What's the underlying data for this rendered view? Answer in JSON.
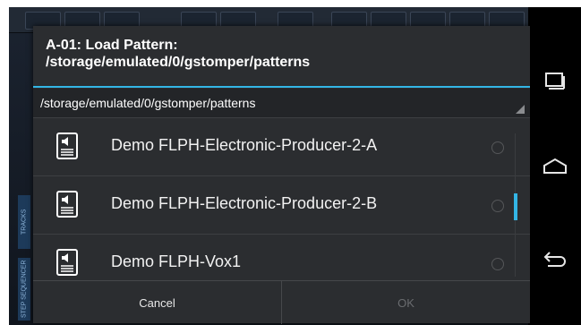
{
  "dialog": {
    "title_line1": "A-01: Load Pattern:",
    "title_line2": "/storage/emulated/0/gstomper/patterns",
    "path": "/storage/emulated/0/gstomper/patterns",
    "items": [
      {
        "label": "Demo FLPH-Electronic-Producer-2-A",
        "icon": "audio-file-icon"
      },
      {
        "label": "Demo FLPH-Electronic-Producer-2-B",
        "icon": "audio-file-icon"
      },
      {
        "label": "Demo FLPH-Vox1",
        "icon": "audio-file-icon"
      }
    ],
    "cancel_label": "Cancel",
    "ok_label": "OK"
  },
  "background": {
    "tab_tracks": "TRACKS",
    "tab_step_sequencer": "STEP SEQUENCER"
  },
  "colors": {
    "accent": "#33b5e5",
    "dialog_bg": "#2b2d30"
  }
}
